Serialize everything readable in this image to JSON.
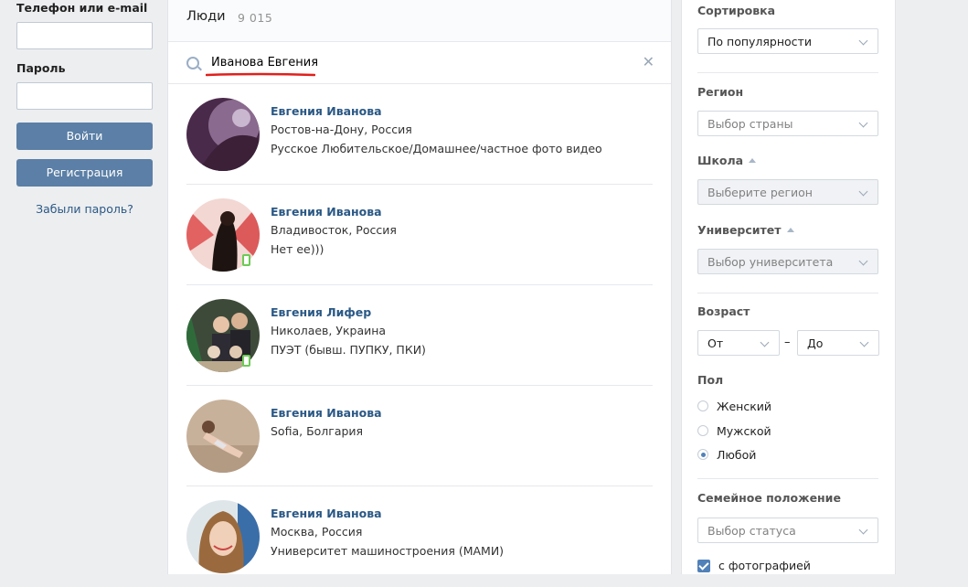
{
  "login": {
    "phone_label": "Телефон или e-mail",
    "phone_value": "",
    "password_label": "Пароль",
    "password_value": "",
    "login_button": "Войти",
    "register_button": "Регистрация",
    "forgot_link": "Забыли пароль?"
  },
  "search": {
    "tab_title": "Люди",
    "count": "9 015",
    "query": "Иванова Евгения",
    "underline_color": "#e0201c"
  },
  "results": [
    {
      "name": "Евгения Иванова",
      "line1": "Ростов-на-Дону, Россия",
      "line2": "Русское Любительское/Домашнее/частное фото видео",
      "mobile": false
    },
    {
      "name": "Евгения Иванова",
      "line1": "Владивосток, Россия",
      "line2": "Нет ее)))",
      "mobile": true
    },
    {
      "name": "Евгения Лифер",
      "line1": "Николаев, Украина",
      "line2": "ПУЭТ (бывш. ПУПКУ, ПКИ)",
      "mobile": true
    },
    {
      "name": "Евгения Иванова",
      "line1": "Sofia, Болгария",
      "line2": "",
      "mobile": false
    },
    {
      "name": "Евгения Иванова",
      "line1": "Москва, Россия",
      "line2": "Университет машиностроения (МАМИ)",
      "mobile": false
    }
  ],
  "filters": {
    "sort_title": "Сортировка",
    "sort_value": "По популярности",
    "region_title": "Регион",
    "region_placeholder": "Выбор страны",
    "school_title": "Школа",
    "school_placeholder": "Выберите регион",
    "university_title": "Университет",
    "university_placeholder": "Выбор университета",
    "age_title": "Возраст",
    "age_from": "От",
    "age_dash": "–",
    "age_to": "До",
    "gender_title": "Пол",
    "gender_options": [
      "Женский",
      "Мужской",
      "Любой"
    ],
    "gender_selected": "Любой",
    "marital_title": "Семейное положение",
    "marital_placeholder": "Выбор статуса",
    "photo_checkbox": "с фотографией",
    "photo_checked": true
  },
  "colors": {
    "link": "#2a5885",
    "button": "#5b7fa6",
    "accent": "#5181b8",
    "online_mobile": "#6ccb55"
  }
}
